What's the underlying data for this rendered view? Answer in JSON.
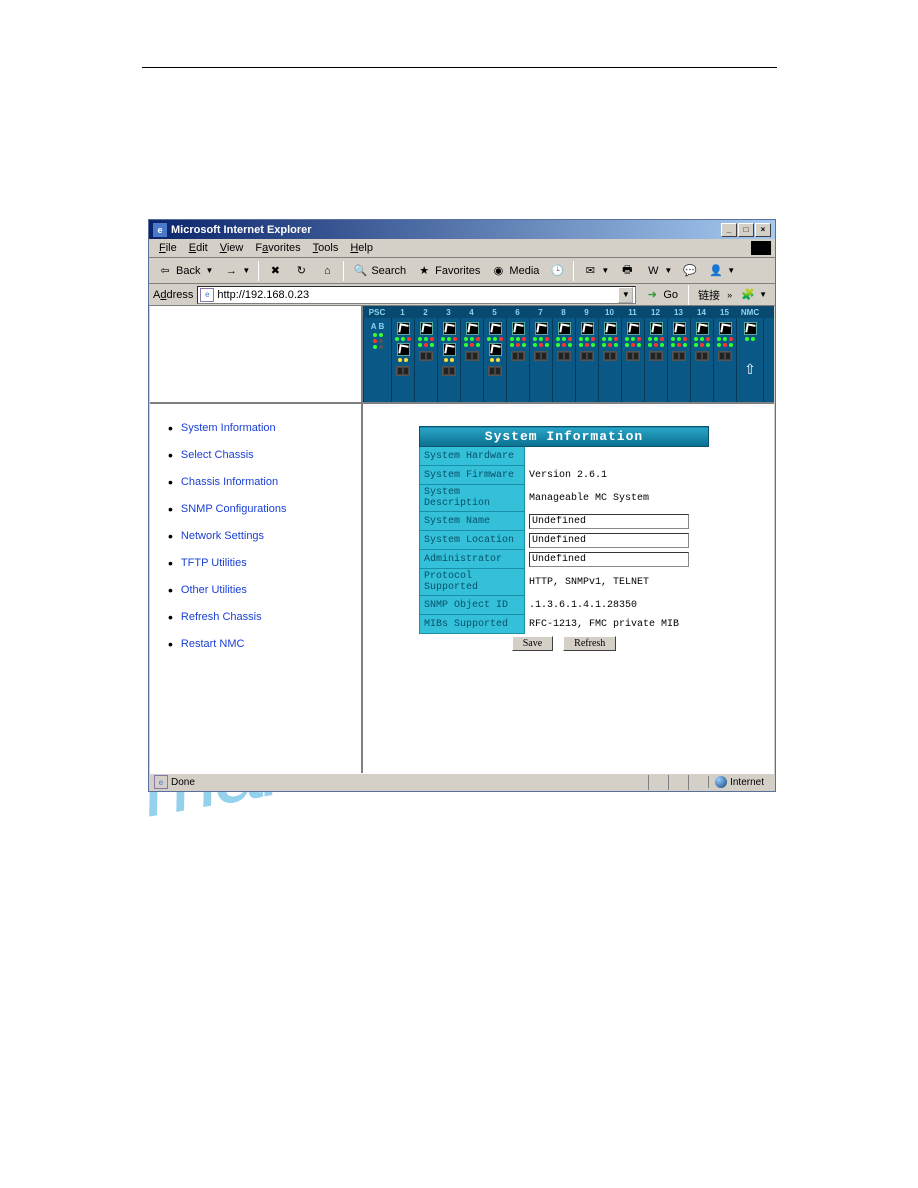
{
  "window": {
    "title": "Microsoft Internet Explorer"
  },
  "menu": {
    "file": "File",
    "edit": "Edit",
    "view": "View",
    "favorites": "Favorites",
    "tools": "Tools",
    "help": "Help"
  },
  "toolbar": {
    "back": "Back",
    "search": "Search",
    "favorites": "Favorites",
    "media": "Media"
  },
  "addressbar": {
    "label": "Address",
    "url": "http://192.168.0.23",
    "go": "Go",
    "links": "链接"
  },
  "nav": {
    "items": [
      "System Information",
      "Select Chassis",
      "Chassis Information",
      "SNMP Configurations",
      "Network Settings",
      "TFTP Utilities",
      "Other Utilities",
      "Refresh Chassis",
      "Restart NMC"
    ]
  },
  "chassis": {
    "psc": "PSC",
    "nmc": "NMC",
    "ab": "A B",
    "slots": [
      "1",
      "2",
      "3",
      "4",
      "5",
      "6",
      "7",
      "8",
      "9",
      "10",
      "11",
      "12",
      "13",
      "14",
      "15"
    ]
  },
  "panel": {
    "title": "System Information",
    "rows": {
      "hw_label": "System Hardware",
      "hw_value": "",
      "fw_label": "System Firmware",
      "fw_value": "Version 2.6.1",
      "desc_label": "System Description",
      "desc_value": "Manageable MC System",
      "name_label": "System Name",
      "name_value": "Undefined",
      "loc_label": "System Location",
      "loc_value": "Undefined",
      "admin_label": "Administrator",
      "admin_value": "Undefined",
      "proto_label": "Protocol Supported",
      "proto_value": "HTTP, SNMPv1, TELNET",
      "oid_label": "SNMP Object ID",
      "oid_value": ".1.3.6.1.4.1.28350",
      "mib_label": "MIBs Supported",
      "mib_value": "RFC-1213, FMC private MIB"
    },
    "save": "Save",
    "refresh": "Refresh"
  },
  "status": {
    "done": "Done",
    "zone": "Internet"
  },
  "watermark": "manualsr"
}
